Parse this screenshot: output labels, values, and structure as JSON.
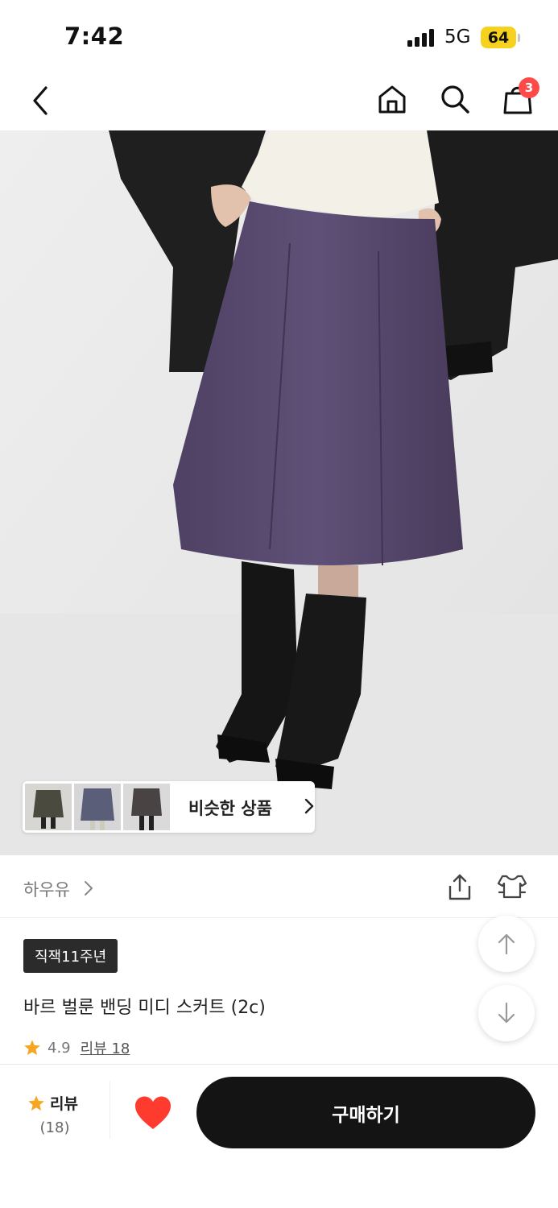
{
  "status_bar": {
    "time": "7:42",
    "network": "5G",
    "battery": "64"
  },
  "nav": {
    "cart_count": "3"
  },
  "similar": {
    "label": "비슷한 상품"
  },
  "shop": {
    "name": "하우유"
  },
  "product": {
    "badge": "직잭11주년",
    "title": "바르 벌룬 밴딩 미디 스커트 (2c)",
    "rating": "4.9",
    "review_link": "리뷰 18"
  },
  "bottom_bar": {
    "review_label": "리뷰",
    "review_count": "(18)",
    "buy_label": "구매하기"
  },
  "colors": {
    "star": "#f5a623",
    "heart": "#ff3b30",
    "badge_bg": "#2b2b2b",
    "buy_bg": "#141414",
    "cart_badge": "#ff4a4a",
    "battery": "#f6d21e"
  },
  "icons": [
    "back-arrow-icon",
    "home-icon",
    "search-icon",
    "shopping-bag-icon",
    "chevron-right-icon",
    "share-icon",
    "fitting-icon",
    "arrow-up-icon",
    "arrow-down-icon",
    "star-icon",
    "heart-icon"
  ]
}
